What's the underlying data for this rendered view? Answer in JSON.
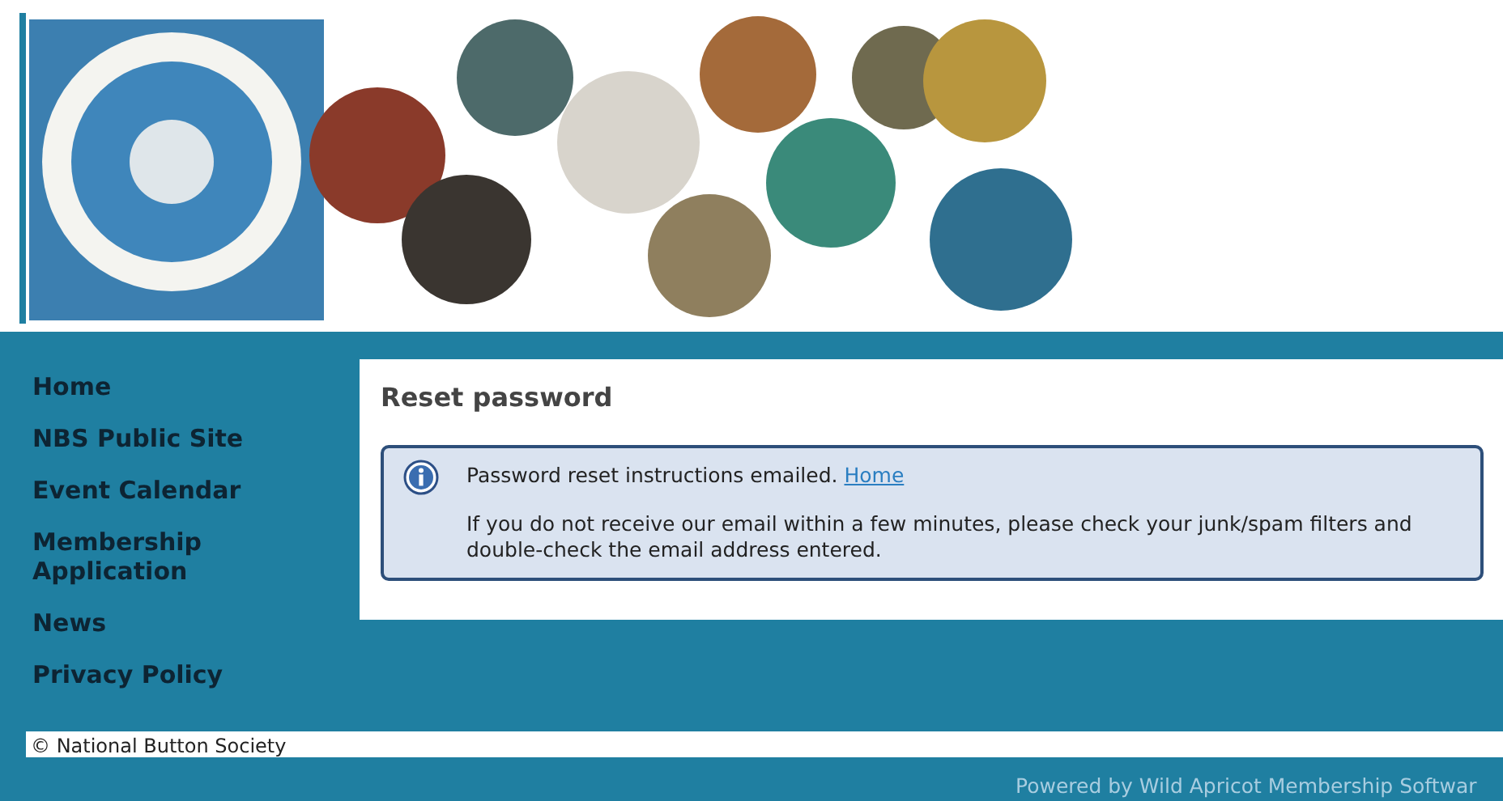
{
  "nav": {
    "items": [
      {
        "label": "Home"
      },
      {
        "label": "NBS Public Site"
      },
      {
        "label": "Event Calendar"
      },
      {
        "label": "Membership Application"
      },
      {
        "label": "News"
      },
      {
        "label": "Privacy Policy"
      }
    ]
  },
  "content": {
    "title": "Reset password",
    "message": {
      "kind": "info",
      "text": "Password reset instructions emailed.",
      "link": "Home",
      "note": "If you do not receive our email within a few minutes, please check your junk/spam filters and double-check the email address entered."
    }
  },
  "footer": {
    "copyright": "© National Button Society",
    "powered_by": "Powered by Wild Apricot Membership Softwar"
  }
}
